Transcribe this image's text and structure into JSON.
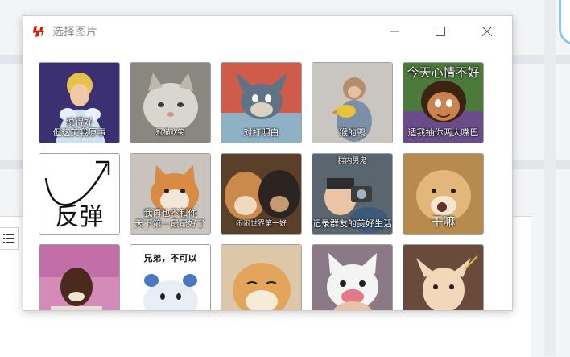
{
  "window": {
    "title": "选择图片"
  },
  "stickers": [
    {
      "caption": "说得好\n但这美我原事"
    },
    {
      "caption": "冠猫欢笑"
    },
    {
      "caption": "对打明白"
    },
    {
      "caption": "猴的鸭"
    },
    {
      "caption_top": "今天心情不好",
      "caption_bottom": "适我抽你两大嘴巴"
    },
    {
      "caption": "反弹"
    },
    {
      "caption": "我再也不和你\n天下第一最最好了"
    },
    {
      "caption": "闹闹世界第一好"
    },
    {
      "caption_top": "群内男鬼",
      "caption_bottom": "记录群友的美好生活"
    },
    {
      "caption": "干嘛"
    },
    {
      "caption": ""
    },
    {
      "caption_top": "兄弟，不可以"
    },
    {
      "caption": ""
    },
    {
      "caption": ""
    },
    {
      "caption": ""
    }
  ],
  "colors": {
    "accent_logo": "#d81e06",
    "border": "#c9ccd1"
  }
}
